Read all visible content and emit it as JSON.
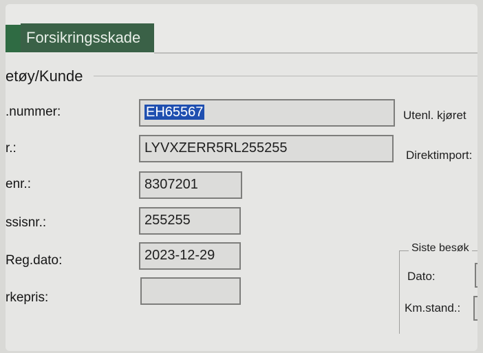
{
  "tabs": {
    "active_label": "Forsikringsskade"
  },
  "group": {
    "title": "etøy/Kunde"
  },
  "fields": {
    "regnr": {
      "label": ".nummer:",
      "value": "EH65567"
    },
    "vin": {
      "label": "r.:",
      "value": "LYVXZERR5RL255255"
    },
    "typenr": {
      "label": "enr.:",
      "value": "8307201"
    },
    "chassisnr": {
      "label": "ssisnr.:",
      "value": "255255"
    },
    "regdato": {
      "label": "Reg.dato:",
      "value": "2023-12-29"
    },
    "merkepris": {
      "label": "rkepris:",
      "value": ""
    }
  },
  "right": {
    "utenl_label": "Utenl. kjøret",
    "direktimport_label": "Direktimport:"
  },
  "siste_besok": {
    "title": "Siste besøk",
    "dato_label": "Dato:",
    "km_label": "Km.stand.:"
  }
}
